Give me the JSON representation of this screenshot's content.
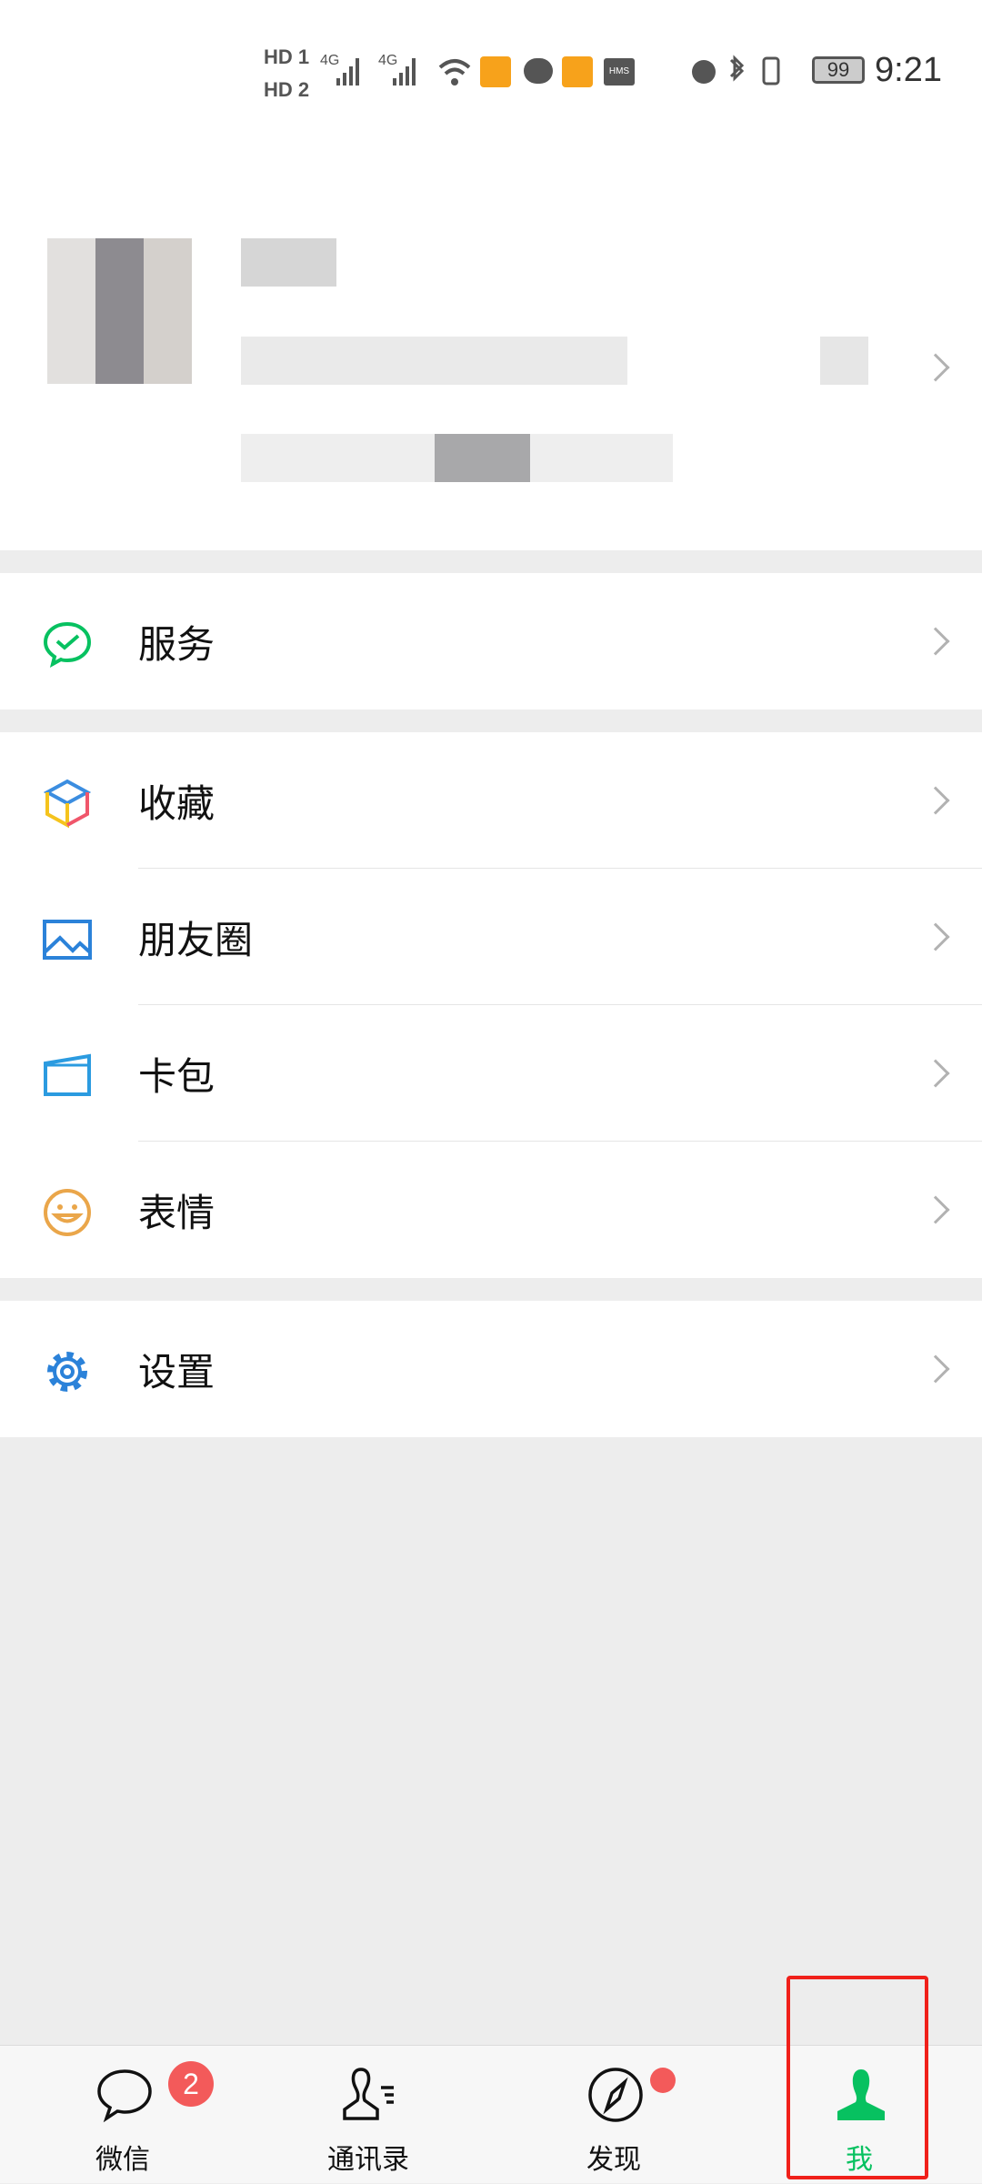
{
  "status_bar": {
    "time": "9:21",
    "battery": "99",
    "sim1": "HD 1",
    "sim2": "HD 2",
    "network1": "4G",
    "network2": "4G",
    "hms": "HMS",
    "icons": [
      "signal-icon",
      "wifi-icon",
      "weibo-icon",
      "message-icon",
      "weibo-icon",
      "hms-icon",
      "alarm-icon",
      "bluetooth-icon",
      "vibrate-icon",
      "battery-icon"
    ]
  },
  "menu": {
    "group1": [
      {
        "label": "服务",
        "icon": "wechat-pay-icon"
      }
    ],
    "group2": [
      {
        "label": "收藏",
        "icon": "favorites-cube-icon"
      },
      {
        "label": "朋友圈",
        "icon": "moments-image-icon"
      },
      {
        "label": "卡包",
        "icon": "card-wallet-icon"
      },
      {
        "label": "表情",
        "icon": "emoji-face-icon"
      }
    ],
    "group3": [
      {
        "label": "设置",
        "icon": "settings-gear-icon"
      }
    ]
  },
  "tabbar": {
    "tabs": [
      {
        "label": "微信",
        "badge": "2"
      },
      {
        "label": "通讯录"
      },
      {
        "label": "发现"
      },
      {
        "label": "我",
        "active": true
      }
    ]
  },
  "colors": {
    "accent": "#07c160",
    "badge": "#f35a5a",
    "highlight": "#f0201a"
  }
}
